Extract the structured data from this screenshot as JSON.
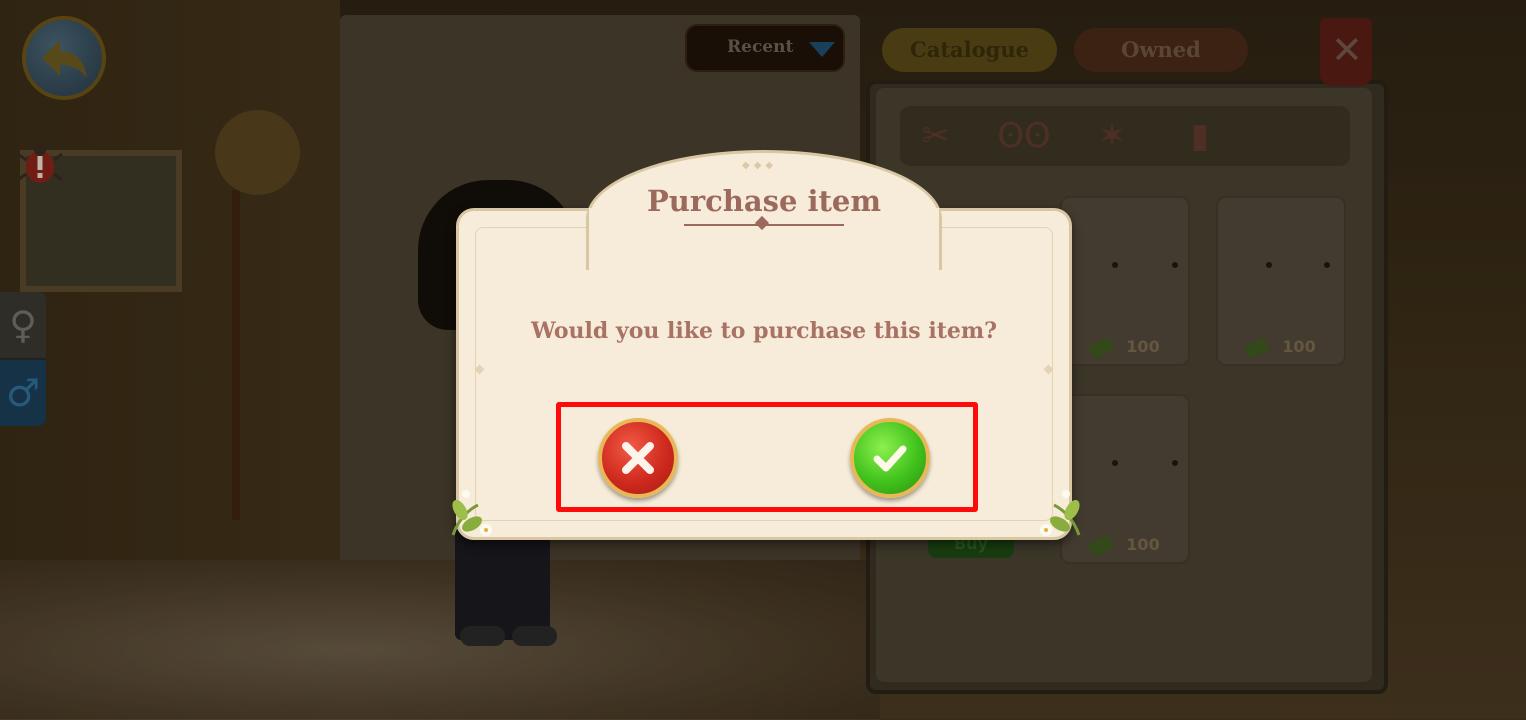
{
  "dialog": {
    "title": "Purchase item",
    "message": "Would you like to purchase this item?",
    "cancel_icon": "close-icon",
    "confirm_icon": "checkmark-icon"
  },
  "background": {
    "recent_dropdown_label": "Recent",
    "tabs": [
      {
        "label": "Catalogue",
        "active": true
      },
      {
        "label": "Owned",
        "active": false
      }
    ],
    "filter_icons": [
      "scissors-icon",
      "eyes-icon",
      "star-icon",
      "color-swatch-icon"
    ],
    "items": [
      {
        "price": "100"
      },
      {
        "price": "100"
      },
      {
        "price": "100"
      }
    ],
    "buy_label": "Buy"
  },
  "colors": {
    "dialog_bg": "#f6ecd9",
    "title_color": "#9c6a5c",
    "highlight": "#ff0a0a",
    "cancel_red": "#cf2a1e",
    "confirm_green": "#41c21c"
  }
}
